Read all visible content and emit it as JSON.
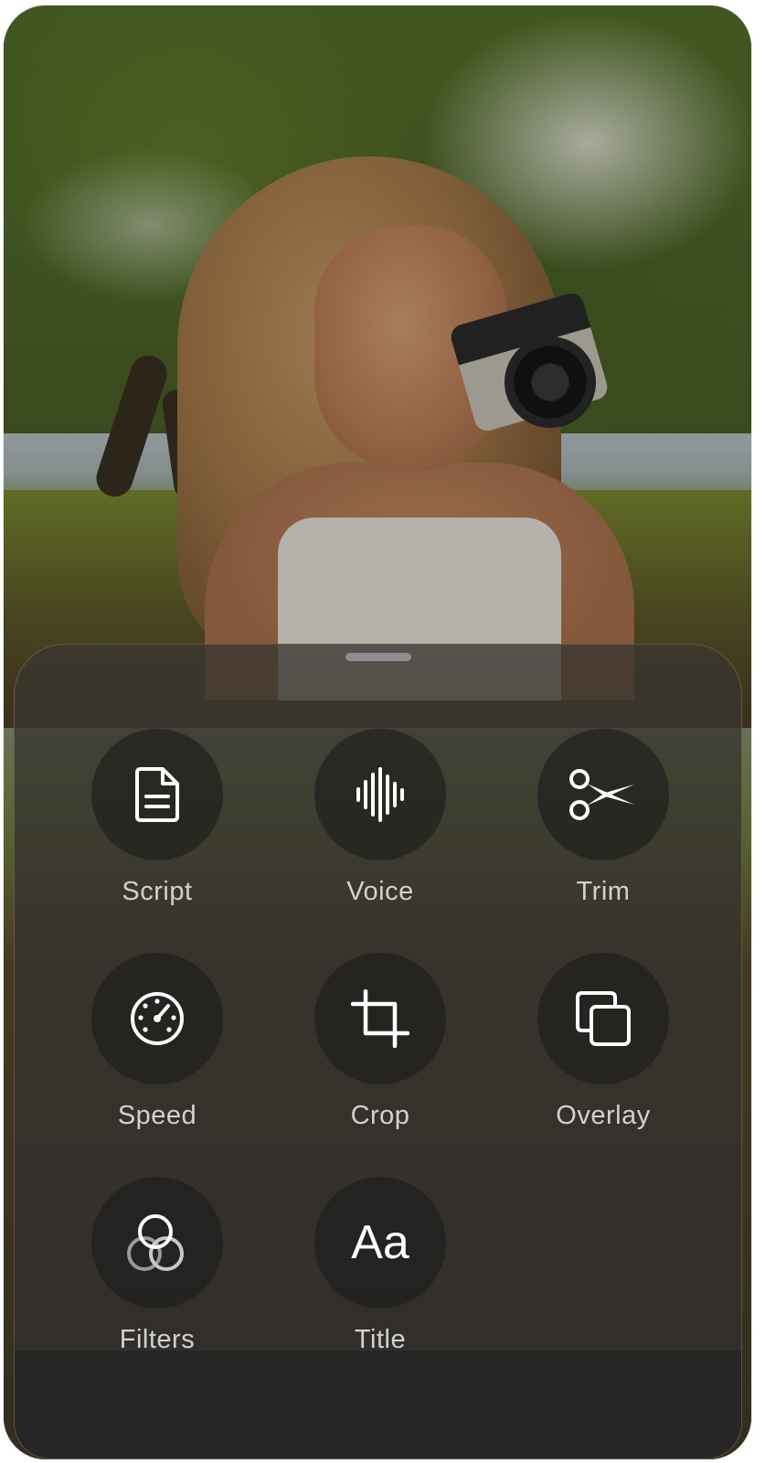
{
  "sheet": {
    "tools": [
      {
        "label": "Script",
        "icon": "document-icon"
      },
      {
        "label": "Voice",
        "icon": "waveform-icon"
      },
      {
        "label": "Trim",
        "icon": "scissors-icon"
      },
      {
        "label": "Speed",
        "icon": "speedometer-icon"
      },
      {
        "label": "Crop",
        "icon": "crop-icon"
      },
      {
        "label": "Overlay",
        "icon": "overlay-icon"
      },
      {
        "label": "Filters",
        "icon": "filters-icon"
      },
      {
        "label": "Title",
        "icon": "text-icon",
        "glyph": "Aa"
      }
    ]
  },
  "colors": {
    "label": "#d2d2d2",
    "icon": "#ffffff",
    "button_bg": "#1c1c1c"
  }
}
